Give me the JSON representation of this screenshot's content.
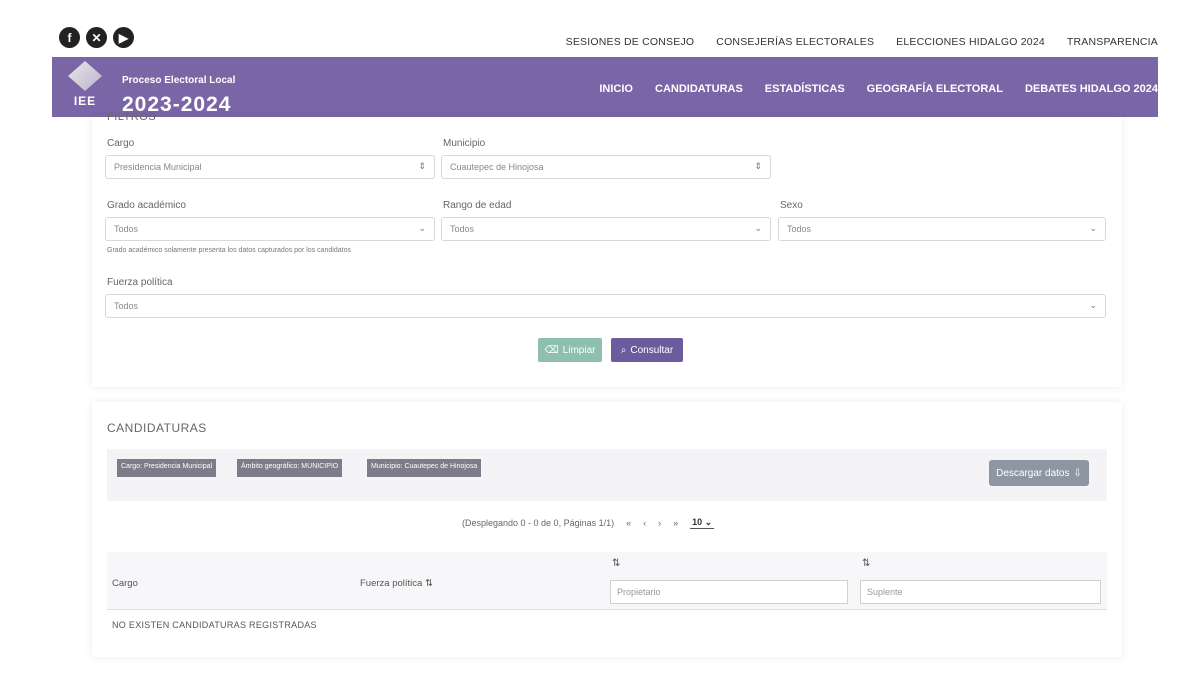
{
  "social": [
    {
      "icon": "facebook-icon",
      "glyph": "f"
    },
    {
      "icon": "x-icon",
      "glyph": "✕"
    },
    {
      "icon": "youtube-icon",
      "glyph": "▶"
    }
  ],
  "top_links": [
    "SESIONES DE CONSEJO",
    "CONSEJERÍAS ELECTORALES",
    "ELECCIONES HIDALGO 2024",
    "TRANSPARENCIA"
  ],
  "header": {
    "logo_text": "IEE",
    "process_label": "Proceso Electoral Local",
    "year": "2023-2024",
    "nav": [
      "INICIO",
      "CANDIDATURAS",
      "ESTADÍSTICAS",
      "GEOGRAFÍA ELECTORAL",
      "DEBATES HIDALGO 2024"
    ]
  },
  "filters": {
    "title": "FILTROS",
    "cargo_label": "Cargo",
    "cargo_value": "Presidencia Municipal",
    "municipio_label": "Municipio",
    "municipio_value": "Cuautepec de Hinojosa",
    "grado_label": "Grado académico",
    "grado_value": "Todos",
    "rango_label": "Rango de edad",
    "rango_value": "Todos",
    "sexo_label": "Sexo",
    "sexo_value": "Todos",
    "note": "Grado académico solamente presenta los datos capturados por los candidatos",
    "fuerza_label": "Fuerza política",
    "fuerza_value": "Todos",
    "clear_label": "Limpiar",
    "query_label": "Consultar"
  },
  "results": {
    "title": "CANDIDATURAS",
    "chips": [
      "Cargo: Presidencia Municipal",
      "Ámbito geográfico: MUNICIPIO",
      "Municipio: Cuautepec de Hinojosa"
    ],
    "download_label": "Descargar datos",
    "pager_text": "(Desplegando 0 - 0 de 0, Páginas 1/1)",
    "pager_first": "«",
    "pager_prev": "‹",
    "pager_next": "›",
    "pager_last": "»",
    "page_size": "10",
    "col_cargo": "Cargo",
    "col_fuerza": "Fuerza política",
    "sort_glyph": "⇅",
    "placeholder_propietario": "Propietario",
    "placeholder_suplente": "Suplente",
    "empty_text": "NO EXISTEN CANDIDATURAS REGISTRADAS"
  },
  "colors": {
    "header_bg": "#7a66a6",
    "consultar_btn": "#6b5c9e",
    "limpiar_btn": "#8fbfb0"
  }
}
